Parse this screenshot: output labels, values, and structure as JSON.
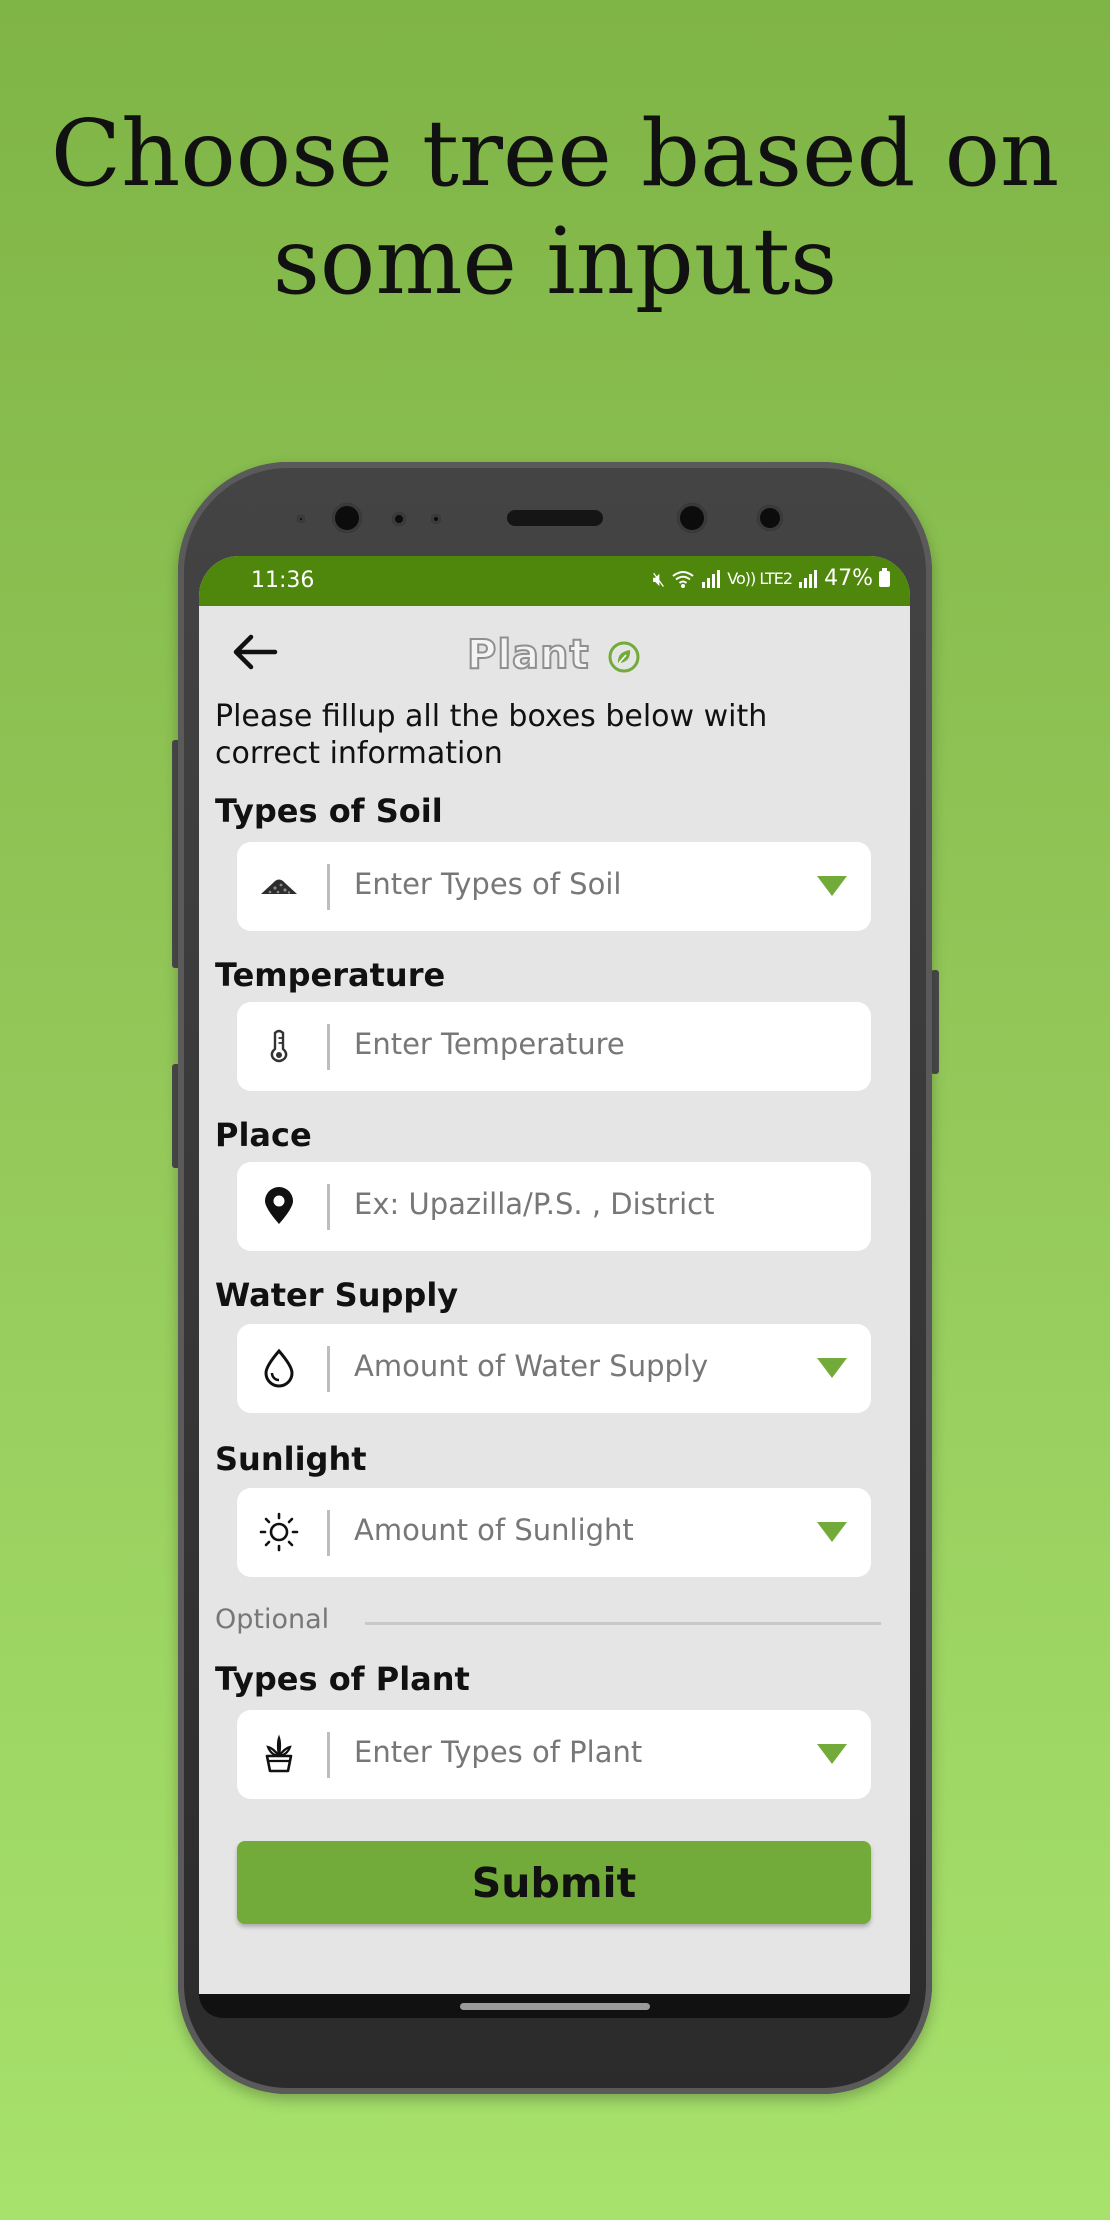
{
  "headline": {
    "line1": "Choose tree based on",
    "line2": "some inputs"
  },
  "status_bar": {
    "time": "11:36",
    "signal_text": "Vo)) LTE2",
    "battery": "47%"
  },
  "app": {
    "logo_text": "Plant"
  },
  "form": {
    "intro": "Please fillup all the boxes below with correct information",
    "fields": [
      {
        "label": "Types of Soil",
        "placeholder": "Enter Types of Soil",
        "icon": "soil-icon",
        "dropdown": true
      },
      {
        "label": "Temperature",
        "placeholder": "Enter Temperature",
        "icon": "thermometer-icon",
        "dropdown": false
      },
      {
        "label": "Place",
        "placeholder": "Ex: Upazilla/P.S. , District",
        "icon": "location-pin-icon",
        "dropdown": false
      },
      {
        "label": "Water Supply",
        "placeholder": "Amount of Water Supply",
        "icon": "water-drop-icon",
        "dropdown": true
      },
      {
        "label": "Sunlight",
        "placeholder": "Amount of Sunlight",
        "icon": "sun-icon",
        "dropdown": true
      },
      {
        "label": "Types of Plant",
        "placeholder": "Enter Types of Plant",
        "icon": "potted-plant-icon",
        "dropdown": true
      }
    ],
    "optional_label": "Optional",
    "submit_label": "Submit"
  },
  "colors": {
    "accent": "#72ab3a",
    "status_bar": "#4f870d",
    "background": "#e5e5e5"
  }
}
